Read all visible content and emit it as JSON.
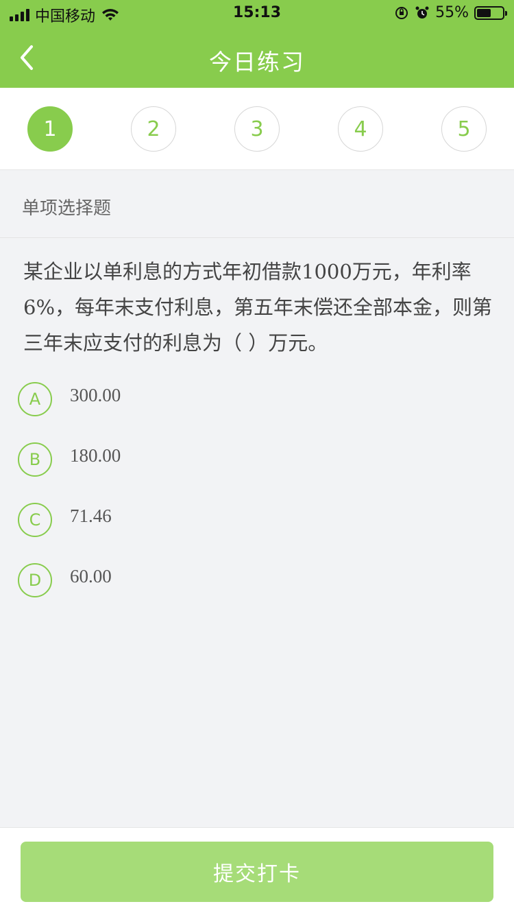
{
  "status_bar": {
    "carrier": "中国移动",
    "time": "15:13",
    "battery_percent": "55%",
    "battery_level": 0.55
  },
  "header": {
    "title": "今日练习",
    "back_icon": "chevron-left-icon",
    "bg_color": "#88cc4d"
  },
  "steps": [
    {
      "label": "1",
      "active": true
    },
    {
      "label": "2",
      "active": false
    },
    {
      "label": "3",
      "active": false
    },
    {
      "label": "4",
      "active": false
    },
    {
      "label": "5",
      "active": false
    }
  ],
  "question": {
    "type": "单项选择题",
    "text": "某企业以单利息的方式年初借款1000万元，年利率6%，每年末支付利息，第五年末偿还全部本金，则第三年末应支付的利息为（    ）万元。",
    "options": [
      {
        "letter": "A",
        "text": "300.00"
      },
      {
        "letter": "B",
        "text": "180.00"
      },
      {
        "letter": "C",
        "text": "71.46"
      },
      {
        "letter": "D",
        "text": "60.00"
      }
    ]
  },
  "footer": {
    "submit_label": "提交打卡",
    "submit_color": "#a6dc78"
  }
}
